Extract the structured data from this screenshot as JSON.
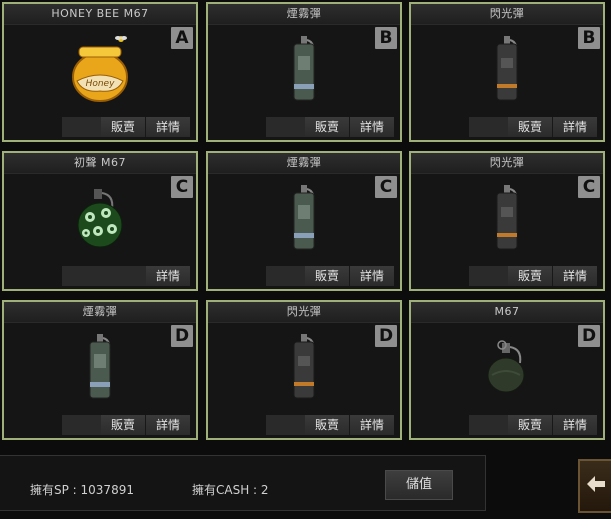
{
  "items": [
    {
      "title": "HONEY BEE M67",
      "grade": "A",
      "icon": "honey-pot-grenade-icon",
      "actions": [
        "販賣",
        "詳情"
      ]
    },
    {
      "title": "煙霧彈",
      "grade": "B",
      "icon": "smoke-grenade-icon",
      "actions": [
        "販賣",
        "詳情"
      ]
    },
    {
      "title": "閃光彈",
      "grade": "B",
      "icon": "flashbang-grenade-icon",
      "actions": [
        "販賣",
        "詳情"
      ]
    },
    {
      "title": "初聲 M67",
      "grade": "C",
      "icon": "green-grenade-icon",
      "actions": [
        "詳情"
      ]
    },
    {
      "title": "煙霧彈",
      "grade": "C",
      "icon": "smoke-grenade-icon",
      "actions": [
        "販賣",
        "詳情"
      ]
    },
    {
      "title": "閃光彈",
      "grade": "C",
      "icon": "flashbang-grenade-icon",
      "actions": [
        "販賣",
        "詳情"
      ]
    },
    {
      "title": "煙霧彈",
      "grade": "D",
      "icon": "smoke-grenade-icon",
      "actions": [
        "販賣",
        "詳情"
      ]
    },
    {
      "title": "閃光彈",
      "grade": "D",
      "icon": "flashbang-grenade-icon",
      "actions": [
        "販賣",
        "詳情"
      ]
    },
    {
      "title": "M67",
      "grade": "D",
      "icon": "frag-grenade-icon",
      "actions": [
        "販賣",
        "詳情"
      ]
    }
  ],
  "footer": {
    "sp_label": "擁有SP : 1037891",
    "cash_label": "擁有CASH : 2",
    "charge_button": "儲值",
    "back_icon": "back-arrow-icon"
  },
  "colors": {
    "card_border": "#9fb07a",
    "grade_badge": "#8f8f8f"
  }
}
